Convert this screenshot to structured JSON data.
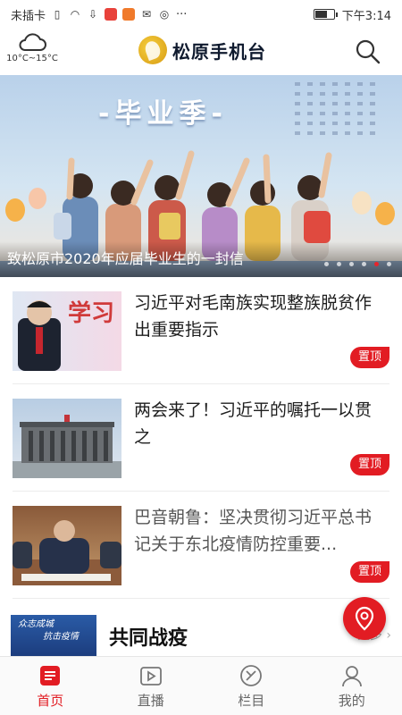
{
  "status_bar": {
    "carrier": "未插卡",
    "more": "···",
    "time": "下午3:14",
    "battery_level": 0.7
  },
  "header": {
    "weather_icon": "cloud-icon",
    "temperature": "10°C~15°C",
    "app_name": "松原手机台",
    "search_icon": "search-icon"
  },
  "banner": {
    "headline_art": "-毕业季-",
    "caption": "致松原市2020年应届毕业生的一封信",
    "slide_count": 6,
    "active_slide": 5
  },
  "news": [
    {
      "title": "习近平对毛南族实现整族脱贫作出重要指示",
      "tag": "置顶",
      "thumb_text": "学习"
    },
    {
      "title": "两会来了！习近平的嘱托一以贯之",
      "tag": "置顶"
    },
    {
      "title": "巴音朝鲁：坚决贯彻习近平总书记关于东北疫情防控重要...",
      "tag": "置顶"
    }
  ],
  "section": {
    "thumb_line1": "众志成城",
    "thumb_line2": "抗击疫情",
    "title": "共同战疫",
    "more": "更多 ›"
  },
  "nav": [
    {
      "label": "首页",
      "icon": "home-news-icon",
      "active": true
    },
    {
      "label": "直播",
      "icon": "live-play-icon",
      "active": false
    },
    {
      "label": "栏目",
      "icon": "columns-icon",
      "active": false
    },
    {
      "label": "我的",
      "icon": "profile-icon",
      "active": false
    }
  ],
  "colors": {
    "accent": "#e21c23",
    "nav_inactive": "#666666"
  }
}
